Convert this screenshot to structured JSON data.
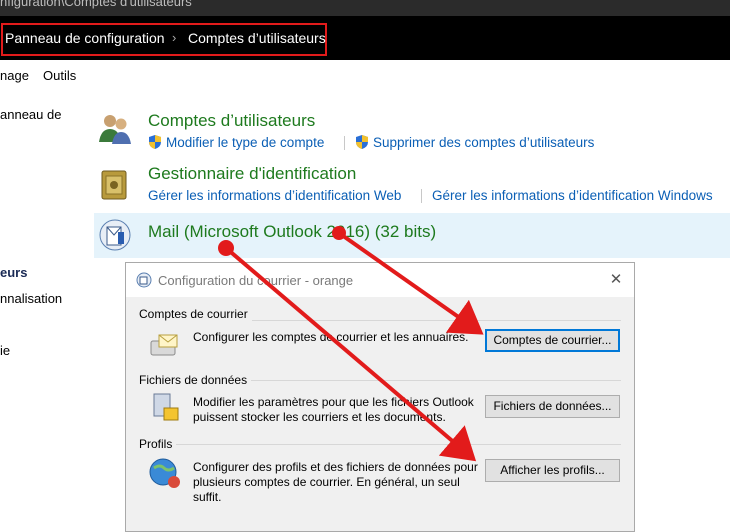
{
  "window": {
    "title": "nfiguration\\Comptes d'utilisateurs"
  },
  "breadcrumb": {
    "items": [
      "Panneau de configuration",
      "Comptes d’utilisateurs"
    ],
    "separator": "›"
  },
  "menu": {
    "items": [
      "nage",
      "Outils"
    ]
  },
  "leftnav": {
    "items": [
      "anneau de",
      "eurs",
      "nnalisation",
      "ie"
    ]
  },
  "categories": [
    {
      "title": "Comptes d’utilisateurs",
      "links": [
        "Modifier le type de compte",
        "Supprimer des comptes d’utilisateurs"
      ]
    },
    {
      "title": "Gestionnaire d'identification",
      "links": [
        "Gérer les informations d’identification Web",
        "Gérer les informations d’identification Windows"
      ]
    },
    {
      "title": "Mail (Microsoft Outlook 2016) (32 bits)",
      "links": []
    }
  ],
  "dialog": {
    "title": "Configuration du courrier - orange",
    "close_label": "✕",
    "groups": [
      {
        "label": "Comptes de courrier",
        "text": "Configurer les comptes de courrier et les annuaires.",
        "button": "Comptes de courrier..."
      },
      {
        "label": "Fichiers de données",
        "text": "Modifier les paramètres pour que les fichiers Outlook puissent stocker les courriers et les documents.",
        "button": "Fichiers de données..."
      },
      {
        "label": "Profils",
        "text": "Configurer des profils et des fichiers de données pour plusieurs comptes de courrier. En général, un seul suffit.",
        "button": "Afficher les profils..."
      }
    ]
  },
  "colors": {
    "annotation": "#e21b1b",
    "link": "#0b5fb5",
    "title_green": "#1e7a1e",
    "highlight": "#e5f3fb"
  }
}
